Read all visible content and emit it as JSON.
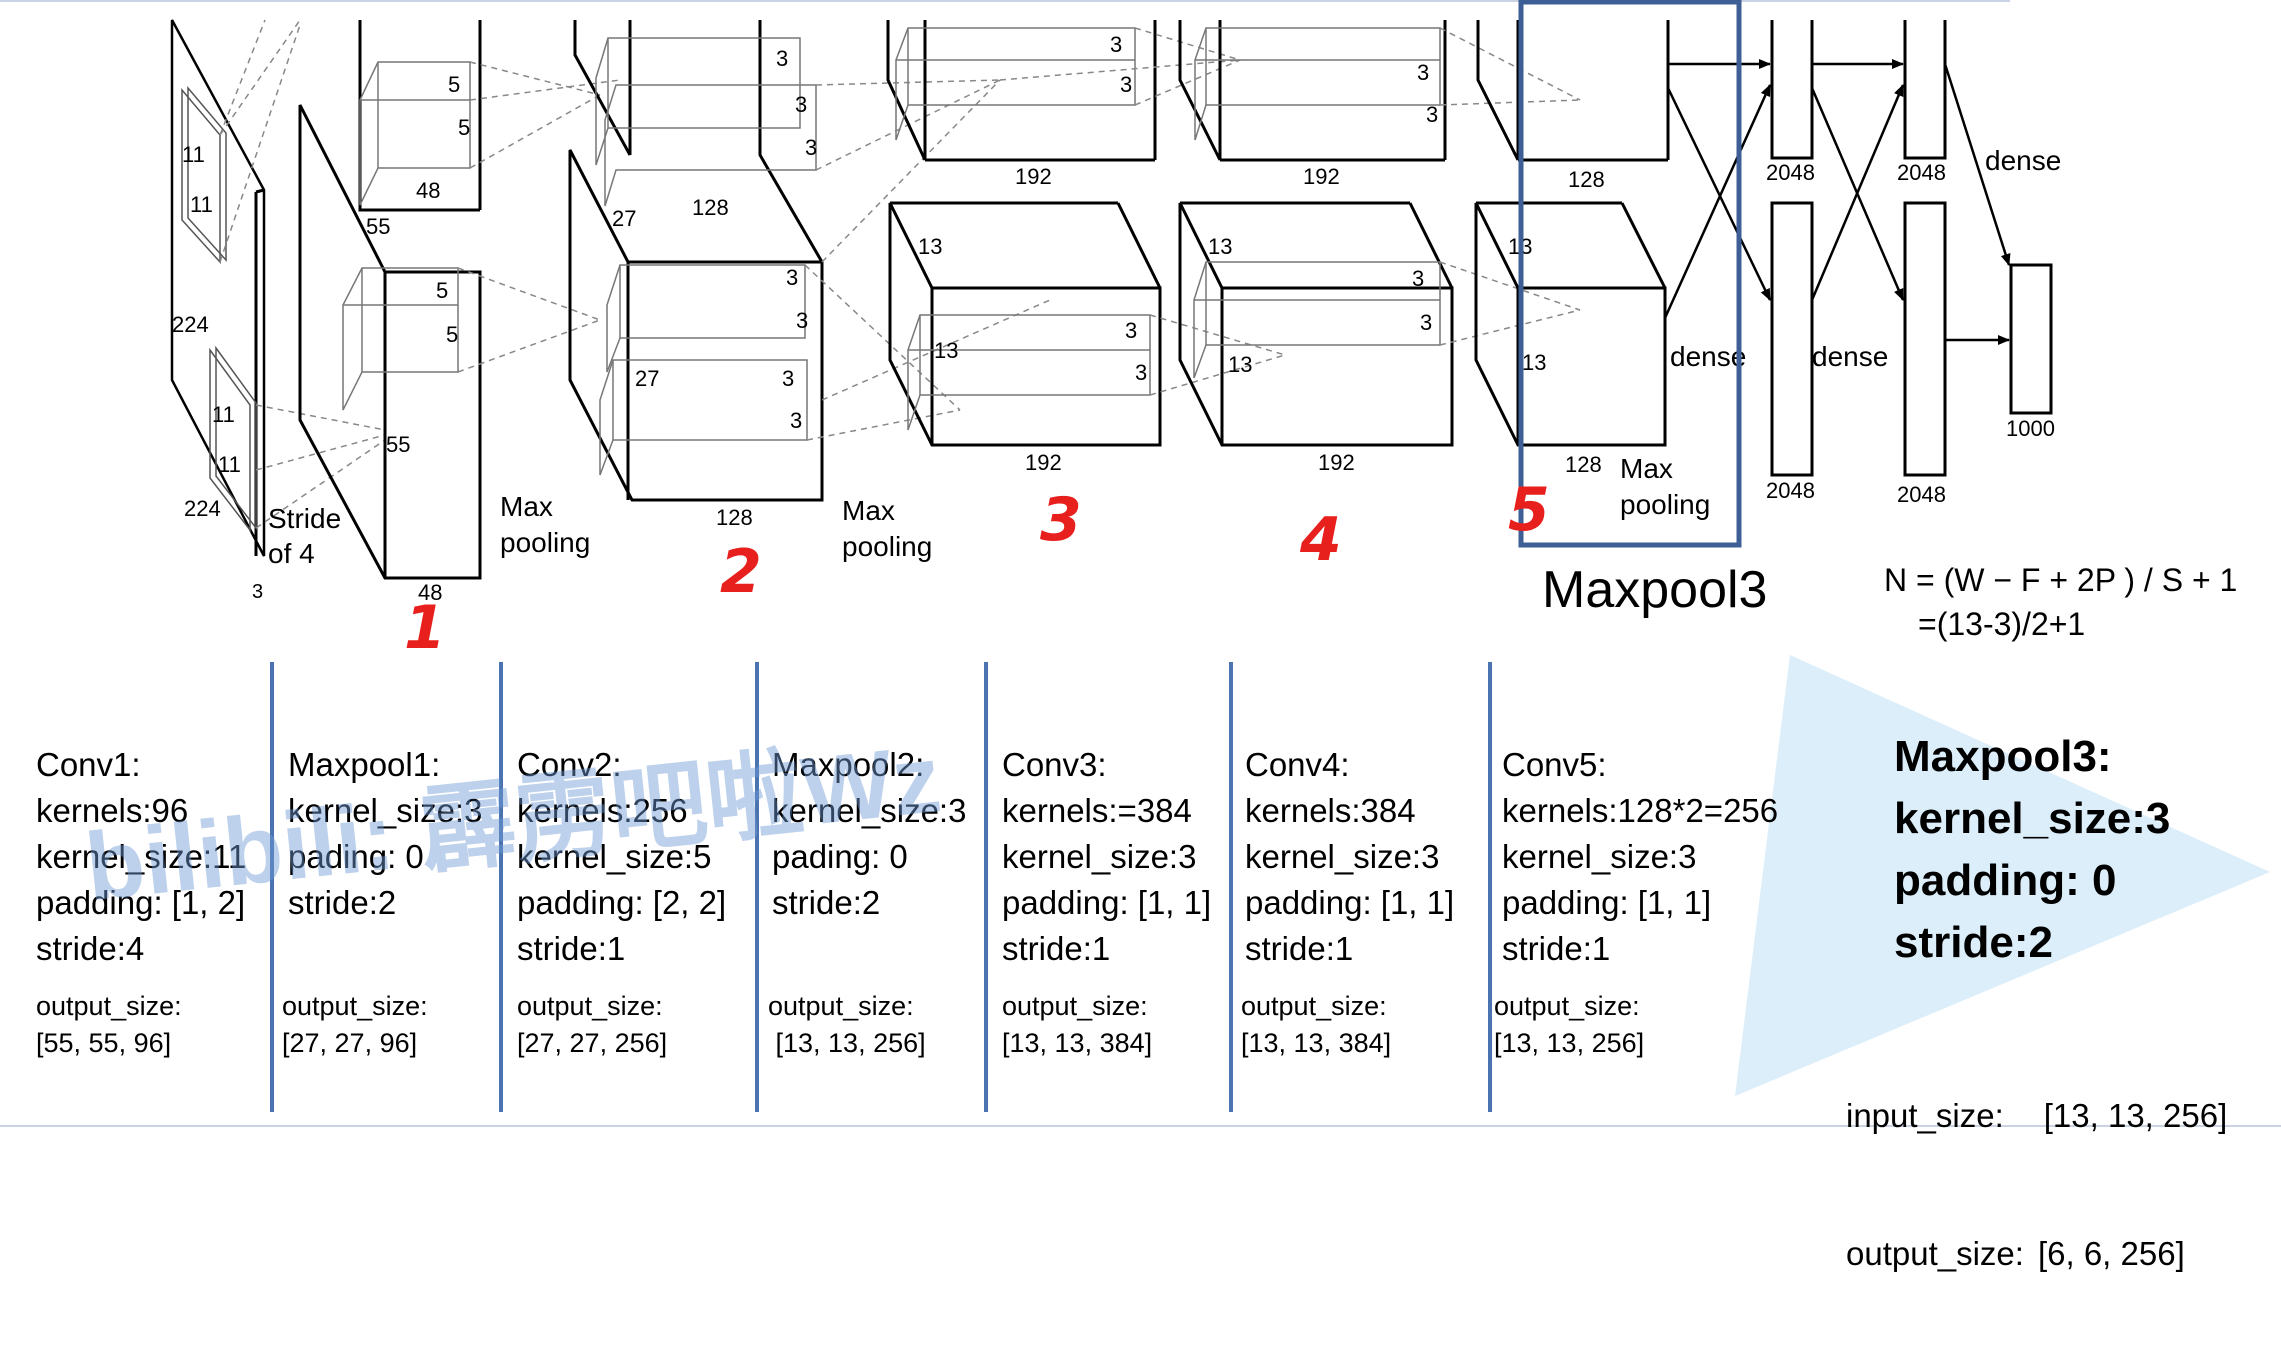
{
  "diagram": {
    "conv1": {
      "dims": [
        "11",
        "11",
        "224",
        "11",
        "11",
        "224",
        "3"
      ],
      "stride_line1": "Stride",
      "stride_line2": "of 4"
    },
    "block1": {
      "dims": [
        "5",
        "5",
        "48",
        "55",
        "5",
        "5",
        "55",
        "48"
      ],
      "pool_line1": "Max",
      "pool_line2": "pooling"
    },
    "block2": {
      "dims": [
        "3",
        "3",
        "3",
        "128",
        "27",
        "3",
        "3",
        "27",
        "3",
        "3",
        "128"
      ],
      "pool_line1": "Max",
      "pool_line2": "pooling"
    },
    "block3": {
      "dims": [
        "3",
        "3",
        "192",
        "13",
        "3",
        "3",
        "13",
        "192"
      ]
    },
    "block4": {
      "dims": [
        "3",
        "3",
        "192",
        "13",
        "3",
        "3",
        "13",
        "192"
      ]
    },
    "block5": {
      "dims": [
        "128",
        "13",
        "13",
        "128"
      ],
      "pool_line1": "Max",
      "pool_line2": "pooling"
    },
    "dense": {
      "labels": [
        "dense",
        "dense",
        "dense"
      ],
      "sizes": [
        "2048",
        "2048",
        "2048",
        "2048",
        "1000"
      ]
    },
    "handwritten": [
      "1",
      "2",
      "3",
      "4",
      "5"
    ],
    "highlight_color": "#3d5f96",
    "handwriting_color": "#e8201d"
  },
  "maxpool3_title": "Maxpool3",
  "formula": {
    "line1": "N = (W − F + 2P ) / S + 1",
    "line2": "=(13-3)/2+1"
  },
  "watermark": "bilibili: 霹雳吧啦Wz",
  "layers": [
    {
      "lines": [
        "Conv1:",
        "kernels:96",
        "kernel_size:11",
        "padding: [1, 2]",
        "stride:4"
      ],
      "output_label": "output_size:",
      "output_value": "[55, 55, 96]"
    },
    {
      "lines": [
        "Maxpool1:",
        "kernel_size:3",
        "pading: 0",
        "stride:2"
      ],
      "output_label": "output_size:",
      "output_value": "[27, 27, 96]"
    },
    {
      "lines": [
        "Conv2:",
        "kernels:256",
        "kernel_size:5",
        "padding: [2, 2]",
        "stride:1"
      ],
      "output_label": "output_size:",
      "output_value": "[27, 27, 256]"
    },
    {
      "lines": [
        "Maxpool2:",
        "kernel_size:3",
        "pading: 0",
        "stride:2"
      ],
      "output_label": "output_size:",
      "output_value": " [13, 13, 256]"
    },
    {
      "lines": [
        "Conv3:",
        "kernels:=384",
        "kernel_size:3",
        "padding: [1, 1]",
        "stride:1"
      ],
      "output_label": "output_size:",
      "output_value": "[13, 13, 384]"
    },
    {
      "lines": [
        "Conv4:",
        "kernels:384",
        "kernel_size:3",
        "padding: [1, 1]",
        "stride:1"
      ],
      "output_label": "output_size:",
      "output_value": "[13, 13, 384]"
    },
    {
      "lines": [
        "Conv5:",
        "kernels:128*2=256",
        "kernel_size:3",
        "padding: [1, 1]",
        "stride:1"
      ],
      "output_label": "output_size:",
      "output_value": "[13, 13, 256]"
    }
  ],
  "focus": {
    "lines": [
      "Maxpool3:",
      "kernel_size:3",
      "padding: 0",
      "stride:2"
    ],
    "input_label": "input_size:",
    "input_value": "[13, 13, 256]",
    "output_label": "output_size:",
    "output_value": "[6, 6, 256]",
    "triangle_color": "#dbeef9"
  }
}
